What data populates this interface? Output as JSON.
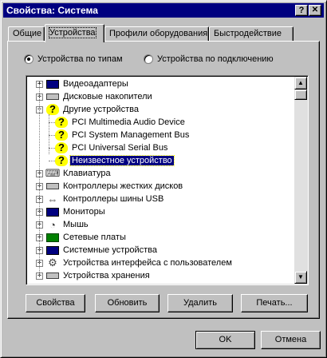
{
  "window": {
    "title": "Свойства: Система",
    "help_glyph": "?",
    "close_glyph": "✕"
  },
  "tabs": [
    {
      "label": "Общие"
    },
    {
      "label": "Устройства"
    },
    {
      "label": "Профили оборудования"
    },
    {
      "label": "Быстродействие"
    }
  ],
  "view": {
    "by_type": "Устройства по типам",
    "by_connection": "Устройства по подключению",
    "selected": "by_type"
  },
  "tree": {
    "items": [
      {
        "label": "Видеоадаптеры",
        "icon": "display-adapter-icon",
        "expander": "+"
      },
      {
        "label": "Дисковые накопители",
        "icon": "disk-drive-icon",
        "expander": "+"
      },
      {
        "label": "Другие устройства",
        "icon": "unknown-device-icon",
        "expander": "−"
      },
      {
        "label": "PCI Multimedia Audio Device",
        "icon": "unknown-device-icon"
      },
      {
        "label": "PCI System Management Bus",
        "icon": "unknown-device-icon"
      },
      {
        "label": "PCI Universal Serial Bus",
        "icon": "unknown-device-icon"
      },
      {
        "label": "Неизвестное устройство",
        "icon": "unknown-device-icon",
        "selected": true
      },
      {
        "label": "Клавиатура",
        "icon": "keyboard-icon",
        "expander": "+"
      },
      {
        "label": "Контроллеры жестких дисков",
        "icon": "hdd-controller-icon",
        "expander": "+"
      },
      {
        "label": "Контроллеры шины USB",
        "icon": "usb-icon",
        "expander": "+"
      },
      {
        "label": "Мониторы",
        "icon": "monitor-icon",
        "expander": "+"
      },
      {
        "label": "Мышь",
        "icon": "mouse-icon",
        "expander": "+"
      },
      {
        "label": "Сетевые платы",
        "icon": "network-card-icon",
        "expander": "+"
      },
      {
        "label": "Системные устройства",
        "icon": "system-devices-icon",
        "expander": "+"
      },
      {
        "label": "Устройства интерфейса с пользователем",
        "icon": "hid-icon",
        "expander": "+"
      },
      {
        "label": "Устройства хранения",
        "icon": "storage-icon",
        "expander": "+"
      }
    ],
    "scroll_up": "▲",
    "scroll_down": "▼"
  },
  "buttons": {
    "properties": "Свойства",
    "refresh": "Обновить",
    "remove": "Удалить",
    "print": "Печать...",
    "ok": "OK",
    "cancel": "Отмена"
  }
}
